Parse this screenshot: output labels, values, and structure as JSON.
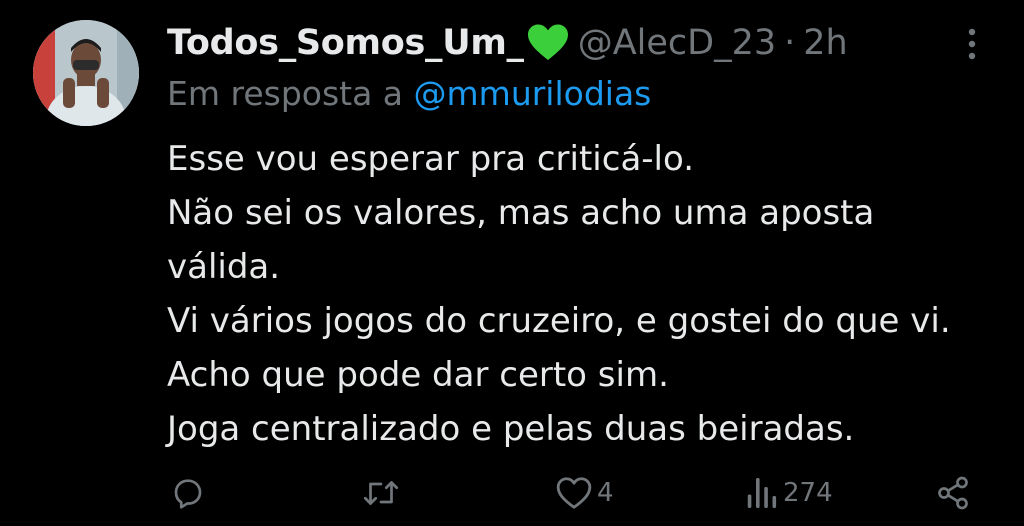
{
  "tweet": {
    "display_name": "Todos_Somos_Um_",
    "badge_icon": "green-heart-icon",
    "handle": "@AlecD_23",
    "separator": "·",
    "time": "2h",
    "reply_prefix": "Em resposta a ",
    "reply_to": "@mmurilodias",
    "body_lines": [
      "Esse vou esperar pra criticá-lo.",
      "Não sei os valores, mas acho uma aposta",
      "válida.",
      "Vi vários jogos do cruzeiro, e gostei do que vi.",
      "Acho que pode dar certo sim.",
      "Joga centralizado e pelas duas beiradas."
    ]
  },
  "actions": {
    "reply_icon": "reply-icon",
    "retweet_icon": "retweet-icon",
    "like_icon": "heart-icon",
    "like_count": "4",
    "views_icon": "views-icon",
    "views_count": "274",
    "share_icon": "share-icon"
  },
  "colors": {
    "background": "#000000",
    "text": "#e7e9ea",
    "muted": "#71767b",
    "link": "#1d9bf0",
    "heart_badge": "#3ccf3c"
  }
}
